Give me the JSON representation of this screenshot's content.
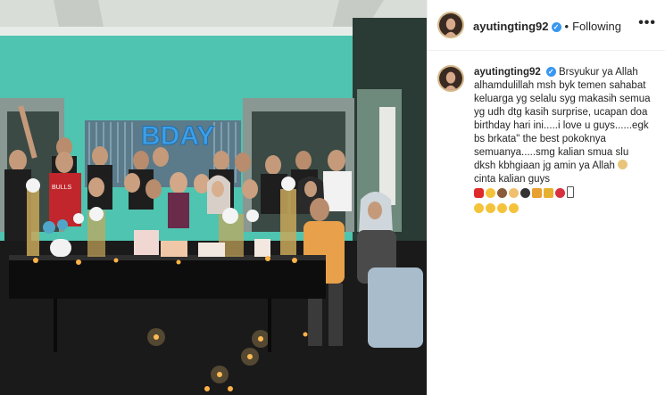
{
  "post": {
    "username": "ayutingting92",
    "verified_mark": "✓",
    "separator": "•",
    "follow_status": "Following",
    "more_label": "•••"
  },
  "caption": {
    "username": "ayutingting92",
    "text": "Brsyukur ya Allah alhamdulillah msh byk temen sahabat keluarga yg selalu syg makasih semua yg udh dtg kasih surprise, ucapan doa birthday hari ini.....i love u guys......egk bs brkata\" the best pokoknya semuanya.....smg kalian smua slu dksh kbhgiaan jg amin ya Allah",
    "tail": "cinta kalian guys",
    "emojis_line1": [
      "red-heart",
      "grin",
      "cake",
      "cake2",
      "balloon-dark",
      "party",
      "gift",
      "lollipop"
    ],
    "emojis_line2": [
      "grin",
      "grin",
      "grin",
      "grin"
    ]
  },
  "photo": {
    "banner_text": "BDAY",
    "jersey_text": "BULLS"
  },
  "colors": {
    "wall": "#4fc4b0",
    "ceiling": "#d9ddd8",
    "banner": "#3e9fe6",
    "verified": "#3897f0",
    "avatar_ring": "#d6b98a"
  }
}
